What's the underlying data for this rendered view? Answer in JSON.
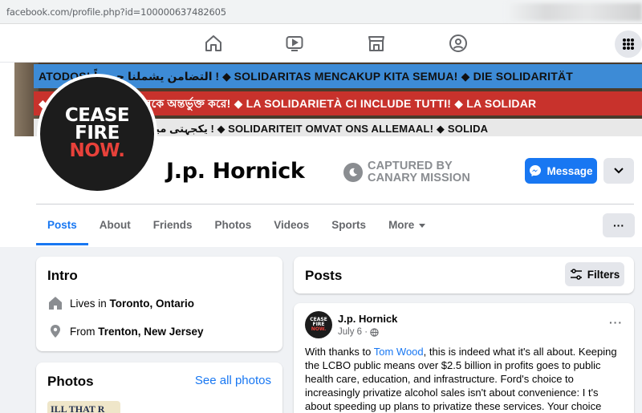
{
  "browser": {
    "url": "facebook.com/profile.php?id=100000637482605"
  },
  "nav": {
    "icons": [
      "home-icon",
      "watch-icon",
      "marketplace-icon",
      "groups-icon"
    ],
    "menu_icon": "grid-menu-icon"
  },
  "cover": {
    "line1": "ATODOS!  التضامن يشملنا جميعاً !  ◆  SOLIDARITAS MENCAKUP KITA SEMUA!  ◆  DIE SOLIDARITÄT",
    "line2": "◆  সংহতি আমাদের সকলকে অন্তর্ভুক্ত করে!  ◆  LA SOLIDARIETÀ CI INCLUDE TUTTI!  ◆  LA SOLIDAR",
    "line3": "◆  یکجہتی میں ہم سب شامل ہیں !  ◆  SOLIDARITEIT OMVAT ONS ALLEMAAL!  ◆  SOLIDA",
    "colors": {
      "band1": "#3d8bd6",
      "band2": "#c8322c",
      "band3": "#e8e8e8"
    }
  },
  "profile": {
    "avatar_lines": [
      "CEASE",
      "FIRE",
      "NOW."
    ],
    "name": "J.p. Hornick",
    "watermark_line1": "CAPTURED BY",
    "watermark_line2": "CANARY MISSION",
    "message_label": "Message"
  },
  "tabs": [
    {
      "label": "Posts",
      "active": true
    },
    {
      "label": "About"
    },
    {
      "label": "Friends"
    },
    {
      "label": "Photos"
    },
    {
      "label": "Videos"
    },
    {
      "label": "Sports"
    },
    {
      "label": "More"
    }
  ],
  "tabs_more_label": "···",
  "intro": {
    "title": "Intro",
    "lives_prefix": "Lives in ",
    "lives_place": "Toronto, Ontario",
    "from_prefix": "From ",
    "from_place": "Trenton, New Jersey"
  },
  "photos": {
    "title": "Photos",
    "see_all": "See all photos",
    "thumb_text": "ILL THAT R"
  },
  "posts": {
    "title": "Posts",
    "filters_label": "Filters",
    "post": {
      "author": "J.p. Hornick",
      "date": "July 6 ·",
      "more": "···",
      "text_before": "With thanks to ",
      "mention": "Tom Wood",
      "text_after": ", this is indeed what it's all about.  Keeping the LCBO public means over $2.5 billion in profits goes to public health care, education, and infrastructure.  Ford's choice to increasingly privatize alcohol sales isn't about convenience: I t's about speeding up plans to privatize these services.  Your choice about"
    }
  },
  "accent": "#1877f2"
}
